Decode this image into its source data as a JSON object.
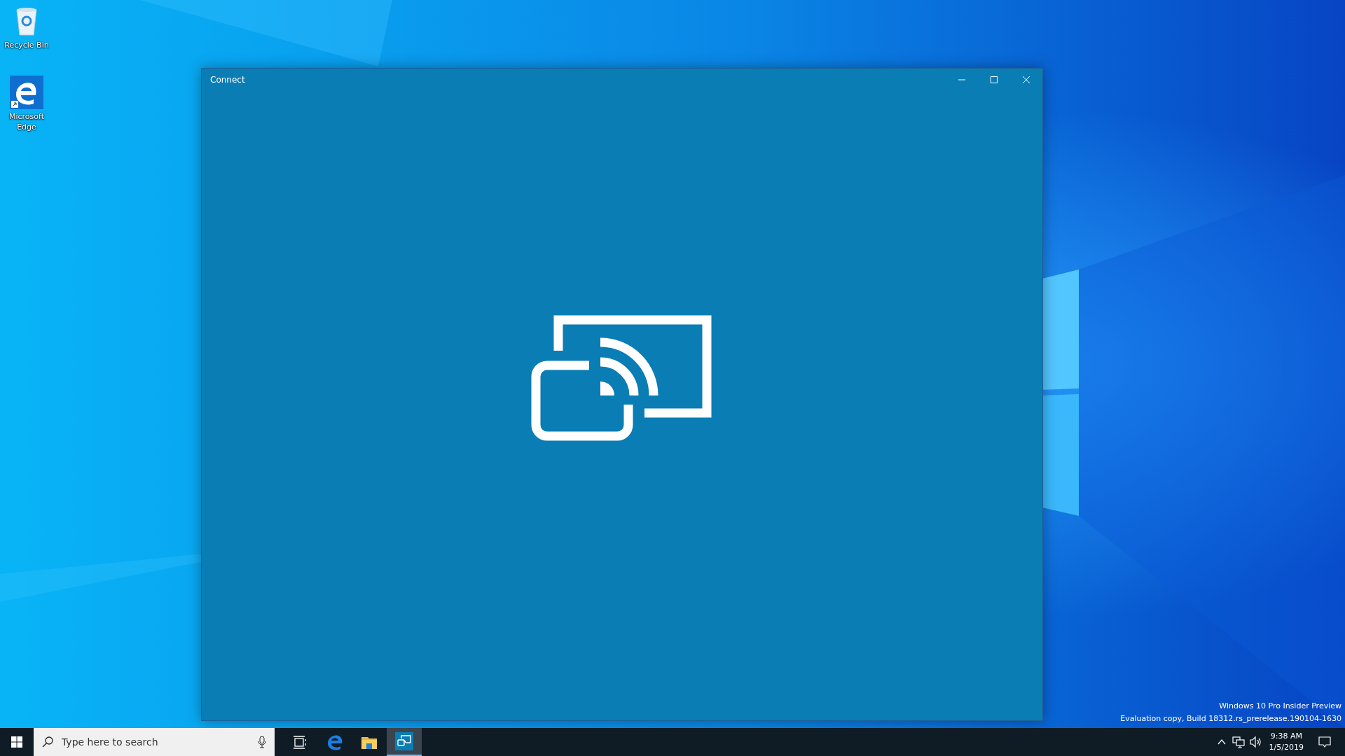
{
  "desktop": {
    "icons": [
      {
        "kind": "recycle",
        "label": "Recycle Bin"
      },
      {
        "kind": "edge",
        "label": "Microsoft Edge"
      }
    ],
    "evaluation_notice": [
      "Windows 10 Pro Insider Preview",
      "Evaluation copy, Build 18312.rs_prerelease.190104-1630"
    ]
  },
  "window": {
    "title": "Connect"
  },
  "taskbar": {
    "search": {
      "placeholder": "Type here to search"
    },
    "apps": [
      {
        "kind": "taskview",
        "selected": false
      },
      {
        "kind": "edge",
        "selected": false
      },
      {
        "kind": "explorer",
        "selected": false
      },
      {
        "kind": "connect",
        "selected": true
      }
    ],
    "clock": {
      "time": "9:38 AM",
      "date": "1/5/2019"
    }
  }
}
